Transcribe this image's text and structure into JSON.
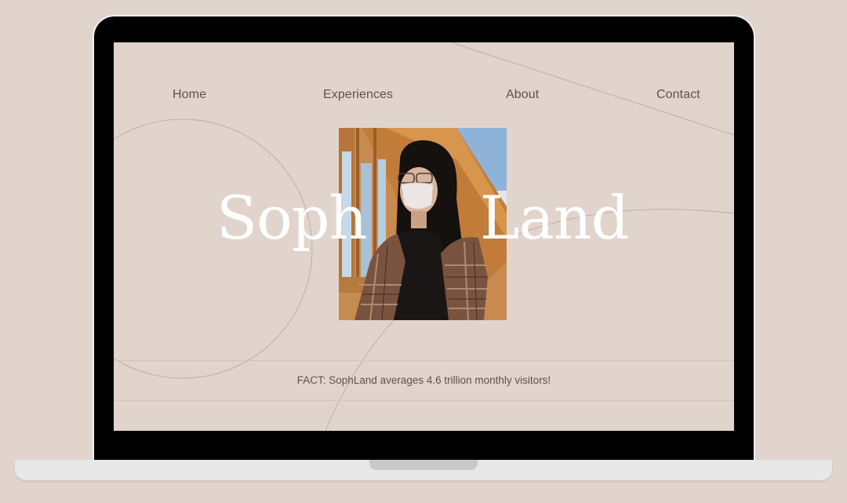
{
  "nav": {
    "home": "Home",
    "experiences": "Experiences",
    "about": "About",
    "contact": "Contact"
  },
  "hero": {
    "title_left": "Soph",
    "title_right": "Land",
    "photo_icon": "portrait-photo"
  },
  "fact": {
    "text": "FACT: SophLand averages 4.6 trillion monthly visitors!"
  },
  "colors": {
    "page_background": "#e1d4cc",
    "bezel": "#000000",
    "base": "#e8e8e8",
    "nav_text": "#5e524c",
    "hero_text": "#ffffff"
  }
}
